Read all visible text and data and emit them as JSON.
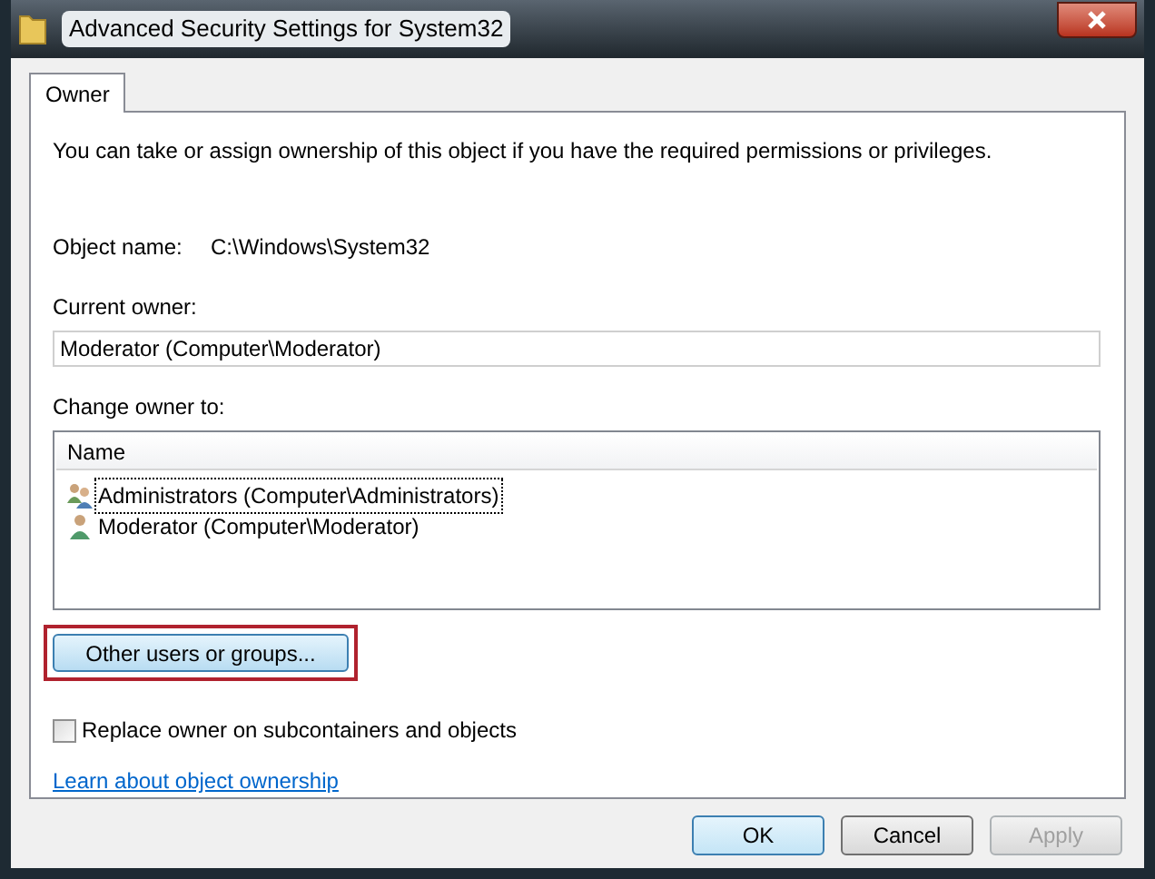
{
  "window": {
    "title": "Advanced Security Settings for System32"
  },
  "tabs": [
    {
      "label": "Owner",
      "selected": true
    }
  ],
  "intro": "You can take or assign ownership of this object if you have the required permissions or privileges.",
  "object_name": {
    "label": "Object name:",
    "value": "C:\\Windows\\System32"
  },
  "current_owner": {
    "label": "Current owner:",
    "value": "Moderator (Computer\\Moderator)"
  },
  "change_owner": {
    "label": "Change owner to:",
    "column": "Name",
    "rows": [
      {
        "kind": "group",
        "label": "Administrators (Computer\\Administrators)",
        "selected": true
      },
      {
        "kind": "user",
        "label": "Moderator (Computer\\Moderator)",
        "selected": false
      }
    ]
  },
  "other_users_button": {
    "label": "Other users or groups...",
    "highlighted": true
  },
  "replace_checkbox": {
    "label": "Replace owner on subcontainers and objects",
    "checked": false
  },
  "link": "Learn about object ownership",
  "buttons": [
    {
      "label": "OK",
      "kind": "default",
      "disabled": false
    },
    {
      "label": "Cancel",
      "kind": "normal",
      "disabled": false
    },
    {
      "label": "Apply",
      "kind": "normal",
      "disabled": true
    }
  ]
}
